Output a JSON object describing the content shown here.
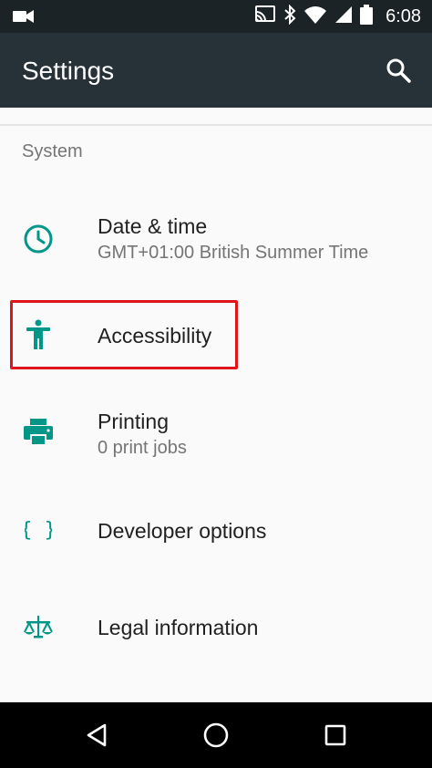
{
  "status_bar": {
    "time": "6:08",
    "icons": [
      "video-camera-icon",
      "cast-icon",
      "bluetooth-icon",
      "wifi-icon",
      "cellular-signal-icon",
      "battery-icon"
    ]
  },
  "app_bar": {
    "title": "Settings",
    "search_icon": "search-icon"
  },
  "section": {
    "header": "System"
  },
  "items": [
    {
      "icon": "clock-icon",
      "title": "Date & time",
      "subtitle": "GMT+01:00 British Summer Time"
    },
    {
      "icon": "accessibility-icon",
      "title": "Accessibility",
      "highlighted": true
    },
    {
      "icon": "printer-icon",
      "title": "Printing",
      "subtitle": "0 print jobs"
    },
    {
      "icon": "braces-icon",
      "title": "Developer options"
    },
    {
      "icon": "balance-scale-icon",
      "title": "Legal information"
    }
  ],
  "nav_bar": {
    "buttons": [
      "back-icon",
      "home-icon",
      "recents-icon"
    ]
  },
  "colors": {
    "status_bar": "#1b2326",
    "app_bar": "#263238",
    "accent": "#009688",
    "highlight": "#e0141b"
  }
}
